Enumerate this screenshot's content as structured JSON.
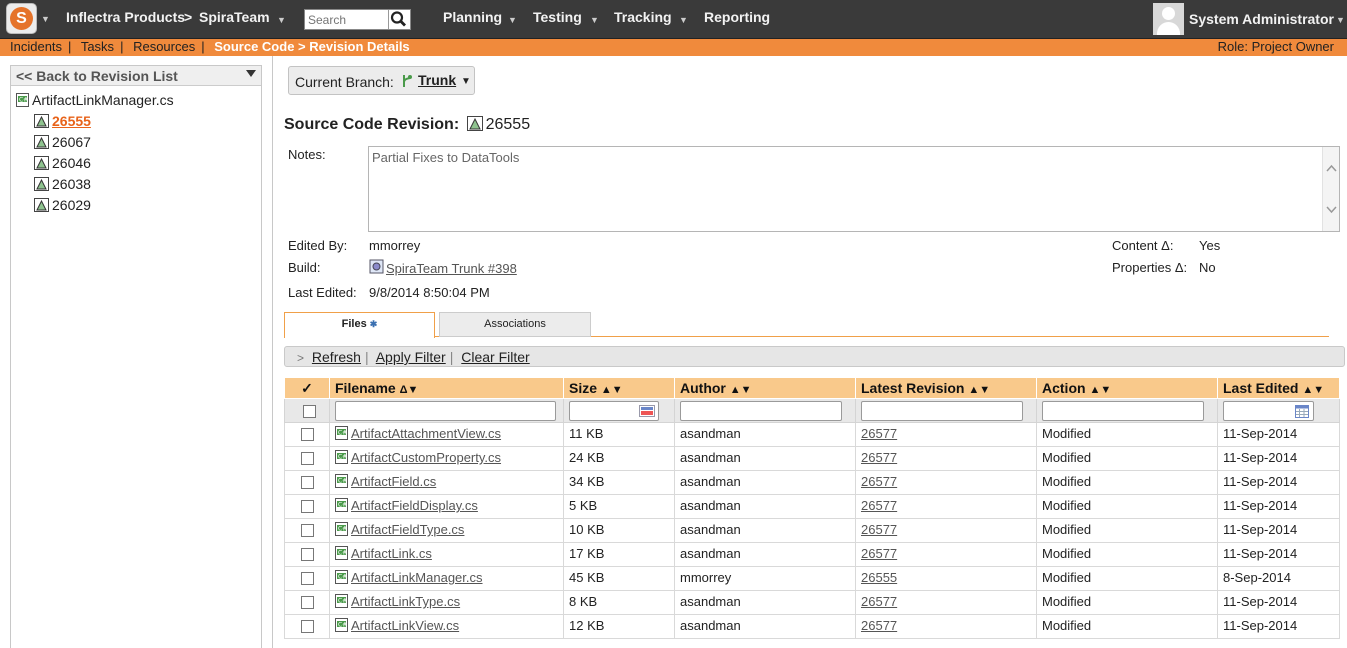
{
  "topbar": {
    "product": "Inflectra Products",
    "arrow": ">",
    "project": "SpiraTeam",
    "search_placeholder": "Search",
    "menu": [
      "Planning",
      "Testing",
      "Tracking",
      "Reporting"
    ],
    "user": "System Administrator"
  },
  "breadcrumb": {
    "links": [
      "Incidents",
      "Tasks",
      "Resources"
    ],
    "current": "Source Code > Revision Details",
    "role": "Role: Project Owner"
  },
  "left": {
    "back": "<< Back to Revision List",
    "file": "ArtifactLinkManager.cs",
    "revisions": [
      "26555",
      "26067",
      "26046",
      "26038",
      "26029"
    ]
  },
  "branch": {
    "label": "Current Branch:",
    "value": "Trunk"
  },
  "revision": {
    "title": "Source Code Revision:",
    "number": "26555",
    "notes_label": "Notes:",
    "notes": "Partial Fixes to DataTools",
    "edited_by_label": "Edited By:",
    "edited_by": "mmorrey",
    "build_label": "Build:",
    "build": "SpiraTeam Trunk #398",
    "last_edited_label": "Last Edited:",
    "last_edited": "9/8/2014 8:50:04 PM",
    "content_label": "Content Δ:",
    "content": "Yes",
    "properties_label": "Properties Δ:",
    "properties": "No"
  },
  "tabs": {
    "files": "Files",
    "associations": "Associations"
  },
  "filterbar": {
    "refresh": "Refresh",
    "apply": "Apply Filter",
    "clear": "Clear Filter"
  },
  "table": {
    "check_header": "✓",
    "columns": [
      "Filename",
      "Size",
      "Author",
      "Latest Revision",
      "Action",
      "Last Edited"
    ],
    "rows": [
      [
        "ArtifactAttachmentView.cs",
        "11 KB",
        "asandman",
        "26577",
        "Modified",
        "11-Sep-2014"
      ],
      [
        "ArtifactCustomProperty.cs",
        "24 KB",
        "asandman",
        "26577",
        "Modified",
        "11-Sep-2014"
      ],
      [
        "ArtifactField.cs",
        "34 KB",
        "asandman",
        "26577",
        "Modified",
        "11-Sep-2014"
      ],
      [
        "ArtifactFieldDisplay.cs",
        "5 KB",
        "asandman",
        "26577",
        "Modified",
        "11-Sep-2014"
      ],
      [
        "ArtifactFieldType.cs",
        "10 KB",
        "asandman",
        "26577",
        "Modified",
        "11-Sep-2014"
      ],
      [
        "ArtifactLink.cs",
        "17 KB",
        "asandman",
        "26577",
        "Modified",
        "11-Sep-2014"
      ],
      [
        "ArtifactLinkManager.cs",
        "45 KB",
        "mmorrey",
        "26555",
        "Modified",
        "8-Sep-2014"
      ],
      [
        "ArtifactLinkType.cs",
        "8 KB",
        "asandman",
        "26577",
        "Modified",
        "11-Sep-2014"
      ],
      [
        "ArtifactLinkView.cs",
        "12 KB",
        "asandman",
        "26577",
        "Modified",
        "11-Sep-2014"
      ]
    ]
  },
  "colors": {
    "topbar": "#3a3a3a",
    "orange": "#f08a3c",
    "header": "#f9c98b",
    "selected": "#e8631a"
  }
}
